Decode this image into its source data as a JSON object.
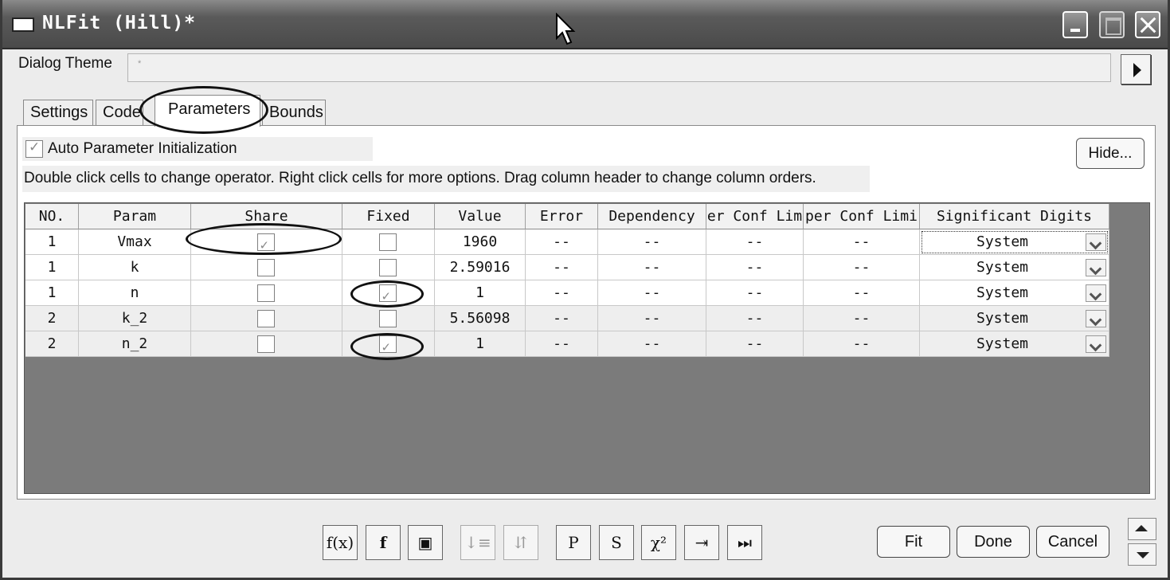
{
  "window": {
    "title": "NLFit (Hill)*"
  },
  "dialog_theme": {
    "label": "Dialog Theme",
    "value": "*"
  },
  "tabs": [
    {
      "label": "Settings"
    },
    {
      "label": "Code"
    },
    {
      "label": "Parameters",
      "selected": true
    },
    {
      "label": "Bounds"
    }
  ],
  "auto_init": {
    "label": "Auto Parameter Initialization",
    "checked": true
  },
  "hide_button": "Hide...",
  "hint": "Double click cells to change operator. Right click cells for more options. Drag column header to change column orders.",
  "table": {
    "headers": [
      "NO.",
      "Param",
      "Share",
      "Fixed",
      "Value",
      "Error",
      "Dependency",
      "er Conf Lim",
      "per Conf Limi",
      "Significant Digits"
    ],
    "rows": [
      {
        "no": "1",
        "param": "Vmax",
        "share": true,
        "fixed": false,
        "value": "1960",
        "error": "--",
        "dependency": "--",
        "lcl": "--",
        "ucl": "--",
        "digits": "System"
      },
      {
        "no": "1",
        "param": "k",
        "share": false,
        "fixed": false,
        "value": "2.59016",
        "error": "--",
        "dependency": "--",
        "lcl": "--",
        "ucl": "--",
        "digits": "System"
      },
      {
        "no": "1",
        "param": "n",
        "share": false,
        "fixed": true,
        "value": "1",
        "error": "--",
        "dependency": "--",
        "lcl": "--",
        "ucl": "--",
        "digits": "System"
      },
      {
        "no": "2",
        "param": "k_2",
        "share": false,
        "fixed": false,
        "value": "5.56098",
        "error": "--",
        "dependency": "--",
        "lcl": "--",
        "ucl": "--",
        "digits": "System"
      },
      {
        "no": "2",
        "param": "n_2",
        "share": false,
        "fixed": true,
        "value": "1",
        "error": "--",
        "dependency": "--",
        "lcl": "--",
        "ucl": "--",
        "digits": "System"
      }
    ]
  },
  "toolbar": {
    "icons": [
      "fx-icon",
      "function-file-icon",
      "save-icon",
      "sort-icon",
      "sort-tree-icon",
      "reset-p-icon",
      "reset-s-icon",
      "chi-square-icon",
      "one-iteration-icon",
      "fit-until-converged-icon"
    ],
    "glyphs": {
      "fx": "f(x)",
      "ff": "f",
      "save": "▣",
      "sort": "↓≡",
      "sort_tree": "⇵",
      "reset_p": "P",
      "reset_s": "S",
      "chi": "χ²",
      "iter1": "⇥",
      "iterN": "⏭"
    }
  },
  "buttons": {
    "fit": "Fit",
    "done": "Done",
    "cancel": "Cancel"
  },
  "colors": {
    "title_bar": "#4f4f4f",
    "grid_background": "#7b7b7b",
    "alt_row": "#eeeeee"
  }
}
